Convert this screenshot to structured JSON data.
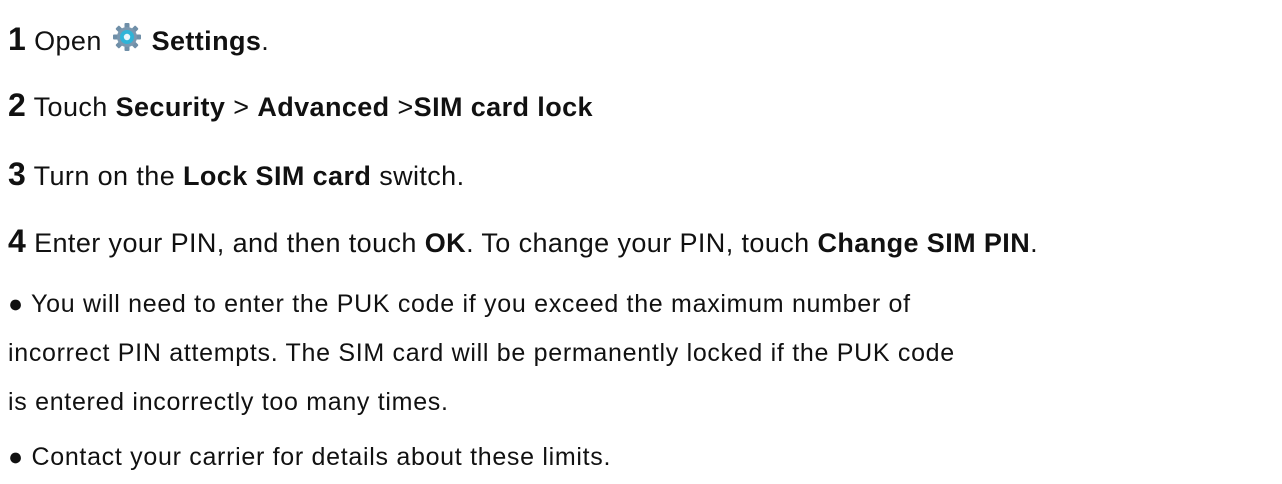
{
  "steps": [
    {
      "number": "1",
      "parts": [
        "Open",
        "Settings",
        "."
      ]
    },
    {
      "number": "2",
      "parts": [
        "Touch",
        "Security",
        ">",
        "Advanced",
        ">",
        "SIM card lock"
      ]
    },
    {
      "number": "3",
      "parts": [
        "Turn on the",
        "Lock SIM card",
        "switch."
      ]
    },
    {
      "number": "4",
      "parts": [
        "Enter your PIN, and then touch",
        "OK",
        ". To change your PIN, touch",
        "Change SIM PIN",
        "."
      ]
    }
  ],
  "notes": {
    "bullet": "●",
    "note1_line1": "You will need to enter the PUK code if you exceed the maximum number of",
    "note1_line2": "incorrect PIN attempts. The SIM card will be permanently locked if the PUK code",
    "note1_line3": "is entered incorrectly too many times.",
    "note2": "Contact your carrier for details about these limits."
  },
  "icons": {
    "settings": "settings-gear-icon"
  },
  "colors": {
    "text": "#111111",
    "gear_outer": "#6f8fa8",
    "gear_inner": "#2fb4d8"
  }
}
